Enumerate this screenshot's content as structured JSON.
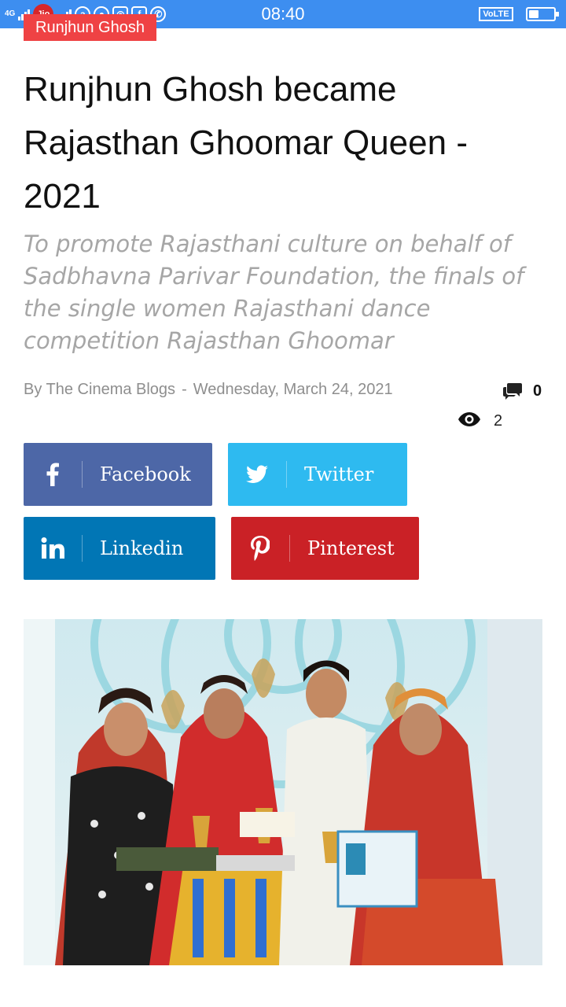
{
  "status_bar": {
    "network": "4G",
    "carrier": "Jio",
    "time": "08:40",
    "volte": "VoLTE",
    "battery_level": 0.4
  },
  "article": {
    "category": "Runjhun Ghosh",
    "title": "Runjhun Ghosh became Rajasthan Ghoomar Queen - 2021",
    "subtitle": "To promote Rajasthani culture on behalf of Sadbhavna Parivar Foundation, the finals of the single women Rajasthani dance competition Rajasthan Ghoomar",
    "author": "By The Cinema Blogs",
    "separator": "-",
    "date": "Wednesday, March 24, 2021",
    "comment_count": "0",
    "view_count": "2"
  },
  "share": {
    "facebook_label": "Facebook",
    "twitter_label": "Twitter",
    "linkedin_label": "Linkedin",
    "pinterest_label": "Pinterest"
  },
  "icons": {
    "comments": "comment-bubbles-icon",
    "views": "eye-icon",
    "facebook": "facebook-icon",
    "twitter": "twitter-bird-icon",
    "linkedin": "linkedin-icon",
    "pinterest": "pinterest-icon"
  },
  "colors": {
    "status_bar": "#3d8ef0",
    "category": "#ef4244",
    "facebook": "#4d67a7",
    "twitter": "#2ebaf0",
    "linkedin": "#0176b5",
    "pinterest": "#ca2126",
    "subtitle": "#a6a6a6"
  }
}
